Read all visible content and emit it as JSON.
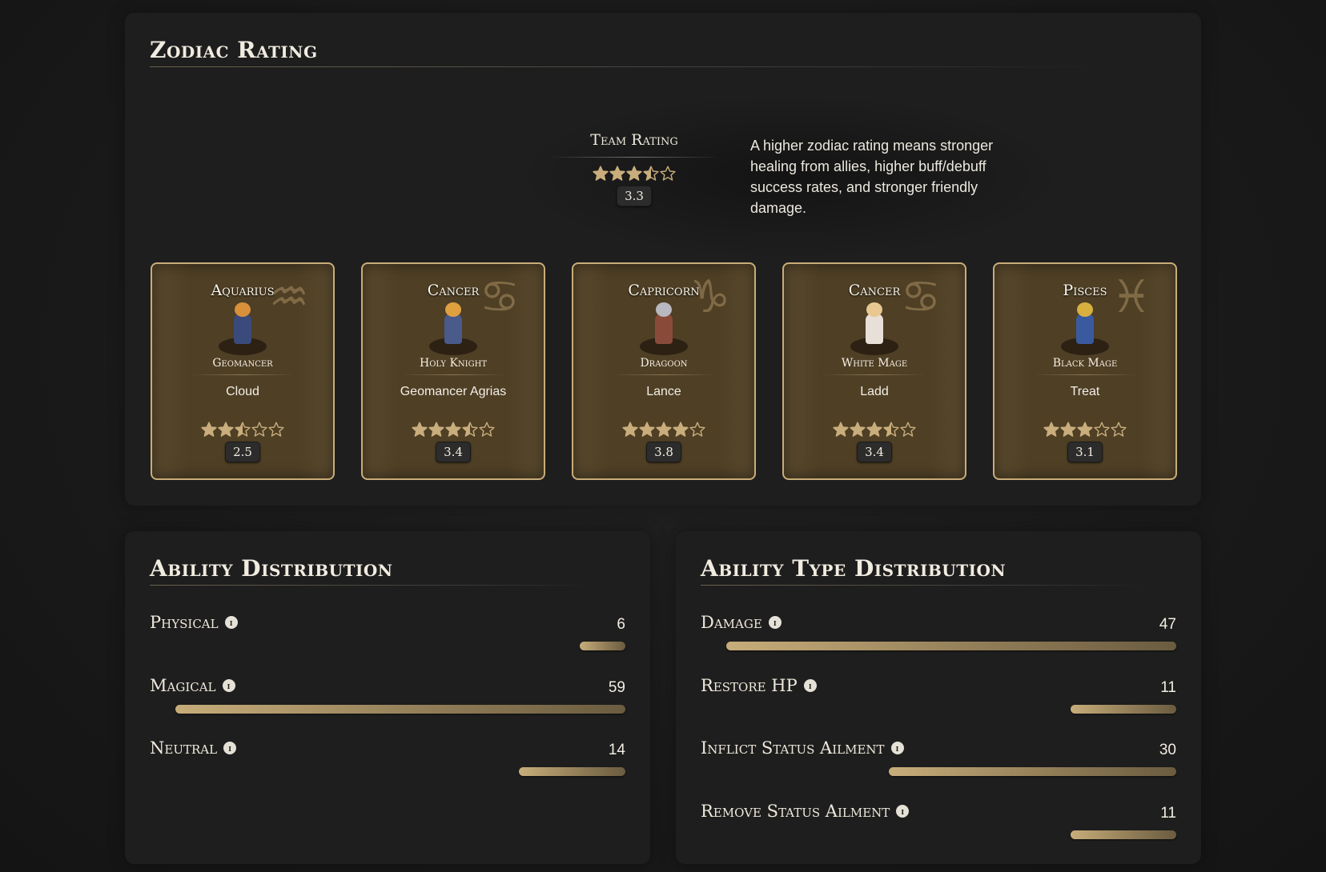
{
  "zodiac": {
    "title": "Zodiac Rating",
    "team": {
      "label": "Team Rating",
      "rating": 3.3,
      "rating_text": "3.3",
      "description": "A higher zodiac rating means stronger healing from allies, higher buff/debuff success rates, and stronger friendly damage."
    },
    "cards": [
      {
        "sign": "Aquarius",
        "glyph": "♒",
        "job": "Geomancer",
        "name": "Cloud",
        "rating": 2.5,
        "rating_text": "2.5",
        "hair": "#d8903a",
        "outfit": "#3a4a7a"
      },
      {
        "sign": "Cancer",
        "glyph": "♋",
        "job": "Holy Knight",
        "name": "Geomancer Agrias",
        "rating": 3.4,
        "rating_text": "3.4",
        "hair": "#e0a040",
        "outfit": "#4a5a8a"
      },
      {
        "sign": "Capricorn",
        "glyph": "♑",
        "job": "Dragoon",
        "name": "Lance",
        "rating": 3.8,
        "rating_text": "3.8",
        "hair": "#b8b8c0",
        "outfit": "#8a4a3a"
      },
      {
        "sign": "Cancer",
        "glyph": "♋",
        "job": "White Mage",
        "name": "Ladd",
        "rating": 3.4,
        "rating_text": "3.4",
        "hair": "#e8c890",
        "outfit": "#e8e0d8"
      },
      {
        "sign": "Pisces",
        "glyph": "♓",
        "job": "Black Mage",
        "name": "Treat",
        "rating": 3.1,
        "rating_text": "3.1",
        "hair": "#d8b040",
        "outfit": "#3a5aa0"
      }
    ]
  },
  "ability_distribution": {
    "title": "Ability Distribution",
    "max": 59,
    "rows": [
      {
        "label": "Physical",
        "value": 6,
        "value_text": "6"
      },
      {
        "label": "Magical",
        "value": 59,
        "value_text": "59"
      },
      {
        "label": "Neutral",
        "value": 14,
        "value_text": "14"
      }
    ]
  },
  "ability_type_distribution": {
    "title": "Ability Type Distribution",
    "max": 47,
    "rows": [
      {
        "label": "Damage",
        "value": 47,
        "value_text": "47"
      },
      {
        "label": "Restore HP",
        "value": 11,
        "value_text": "11"
      },
      {
        "label": "Inflict Status Ailment",
        "value": 30,
        "value_text": "30"
      },
      {
        "label": "Remove Status Ailment",
        "value": 11,
        "value_text": "11"
      }
    ]
  },
  "colors": {
    "star_fill": "#c9ad7c",
    "card_border": "#c9ad78",
    "bar_gradient_start": "#c7ad7a"
  }
}
